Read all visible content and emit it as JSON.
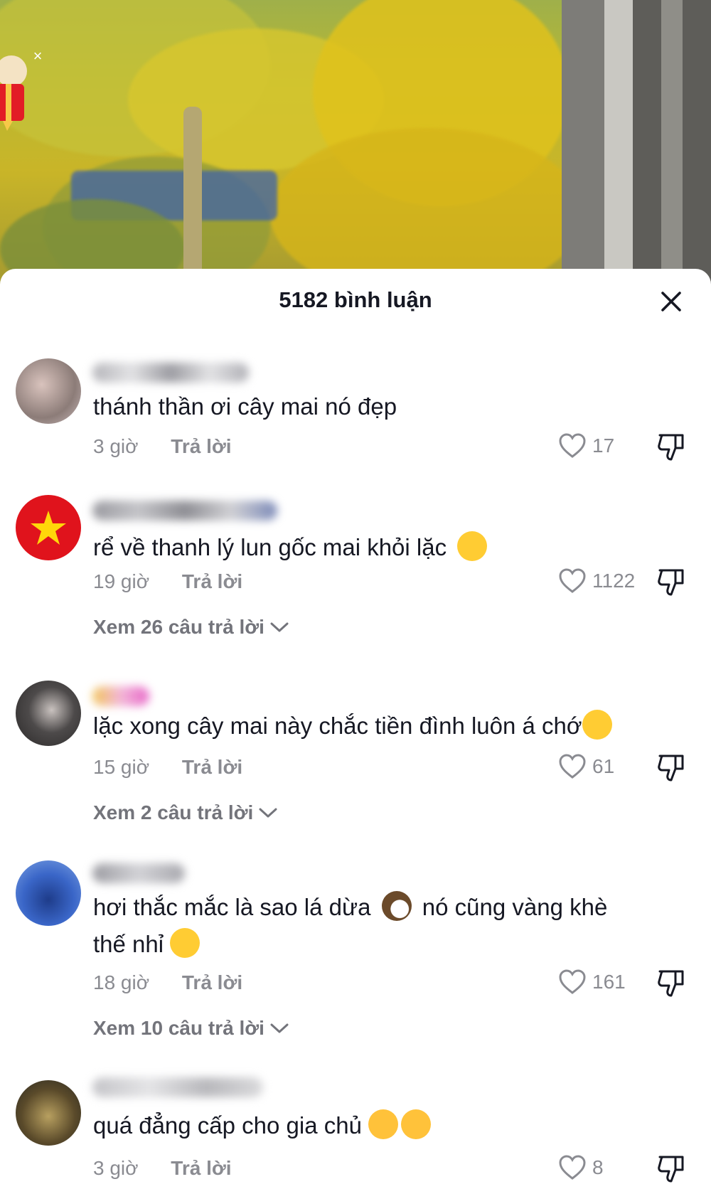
{
  "sheet": {
    "title": "5182 bình luận"
  },
  "comments": [
    {
      "text": "thánh thần ơi cây mai nó đẹp",
      "time": "3 giờ",
      "reply_label": "Trả lời",
      "likes": "17"
    },
    {
      "text": "rể về thanh lý lun gốc mai khỏi lặc",
      "time": "19 giờ",
      "reply_label": "Trả lời",
      "likes": "1122",
      "view_replies": "Xem 26 câu trả lời"
    },
    {
      "text": "lặc xong cây mai này chắc tiền đình luôn á chớ",
      "time": "15 giờ",
      "reply_label": "Trả lời",
      "likes": "61",
      "view_replies": "Xem 2 câu trả lời"
    },
    {
      "text_line1": "hơi thắc mắc là sao lá dừa",
      "text_line1b": "nó cũng vàng khè",
      "text_line2": "thế nhỉ",
      "time": "18 giờ",
      "reply_label": "Trả lời",
      "likes": "161",
      "view_replies": "Xem 10 câu trả lời"
    },
    {
      "text": "quá đẳng cấp cho gia chủ",
      "time": "3 giờ",
      "reply_label": "Trả lời",
      "likes": "8"
    }
  ],
  "icons": {
    "close": "close-icon",
    "like": "heart-outline-icon",
    "dislike": "thumbs-down-icon",
    "expand": "chevron-down-icon"
  },
  "colors": {
    "text": "#161823",
    "muted": "#8a8b91",
    "video_yellow": "#c9b528"
  }
}
